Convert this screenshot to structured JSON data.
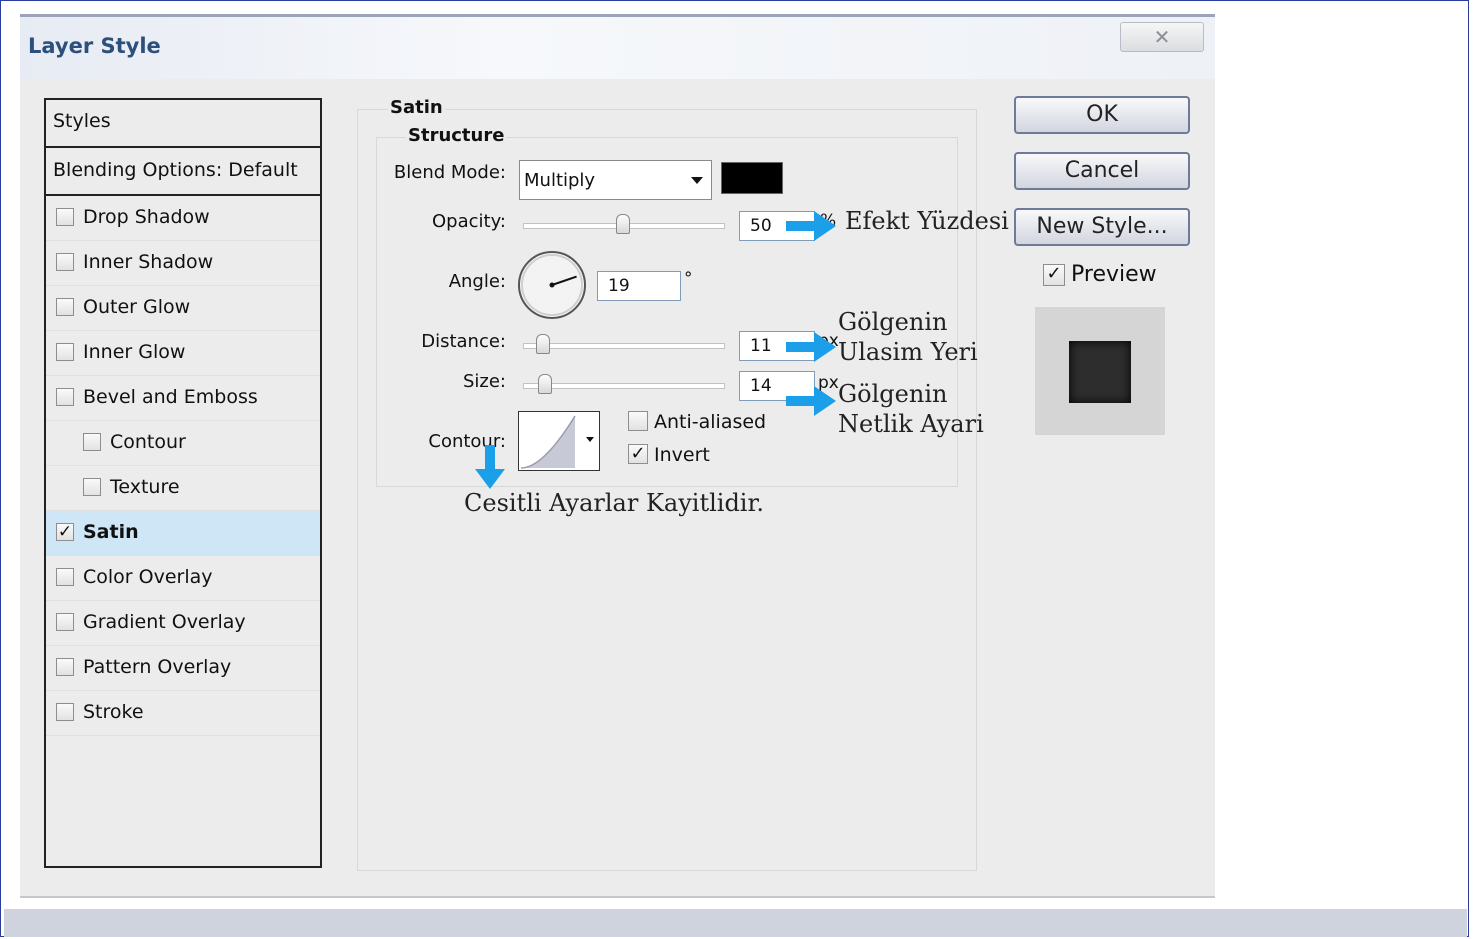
{
  "dialog": {
    "title": "Layer Style",
    "close_glyph": "✕"
  },
  "styles_panel": {
    "header": "Styles",
    "blending_options": "Blending Options: Default",
    "items": [
      {
        "label": "Drop Shadow",
        "checked": false,
        "indent": false,
        "selected": false
      },
      {
        "label": "Inner Shadow",
        "checked": false,
        "indent": false,
        "selected": false
      },
      {
        "label": "Outer Glow",
        "checked": false,
        "indent": false,
        "selected": false
      },
      {
        "label": "Inner Glow",
        "checked": false,
        "indent": false,
        "selected": false
      },
      {
        "label": "Bevel and Emboss",
        "checked": false,
        "indent": false,
        "selected": false
      },
      {
        "label": "Contour",
        "checked": false,
        "indent": true,
        "selected": false
      },
      {
        "label": "Texture",
        "checked": false,
        "indent": true,
        "selected": false
      },
      {
        "label": "Satin",
        "checked": true,
        "indent": false,
        "selected": true
      },
      {
        "label": "Color Overlay",
        "checked": false,
        "indent": false,
        "selected": false
      },
      {
        "label": "Gradient Overlay",
        "checked": false,
        "indent": false,
        "selected": false
      },
      {
        "label": "Pattern Overlay",
        "checked": false,
        "indent": false,
        "selected": false
      },
      {
        "label": "Stroke",
        "checked": false,
        "indent": false,
        "selected": false
      }
    ]
  },
  "satin": {
    "group_title": "Satin",
    "structure_title": "Structure",
    "blend_mode_label": "Blend Mode:",
    "blend_mode_value": "Multiply",
    "blend_color": "#000000",
    "opacity_label": "Opacity:",
    "opacity_value": "50",
    "opacity_unit": "%",
    "opacity_slider_fraction": 0.5,
    "angle_label": "Angle:",
    "angle_value": "19",
    "angle_unit": "°",
    "distance_label": "Distance:",
    "distance_value": "11",
    "distance_unit": "px",
    "size_label": "Size:",
    "size_value": "14",
    "size_unit": "px",
    "contour_label": "Contour:",
    "anti_aliased_label": "Anti-aliased",
    "anti_aliased_checked": false,
    "invert_label": "Invert",
    "invert_checked": true
  },
  "buttons": {
    "ok": "OK",
    "cancel": "Cancel",
    "new_style": "New Style...",
    "preview_label": "Preview",
    "preview_checked": true
  },
  "annotations": {
    "opacity_note": "Efekt Yüzdesi",
    "distance_note": "Gölgenin Ulasim Yeri",
    "size_note": "Gölgenin Netlik Ayari",
    "contour_note": "Cesitli Ayarlar Kayitlidir.",
    "arrow_color": "#1a9fe8"
  },
  "check_glyph": "✓"
}
